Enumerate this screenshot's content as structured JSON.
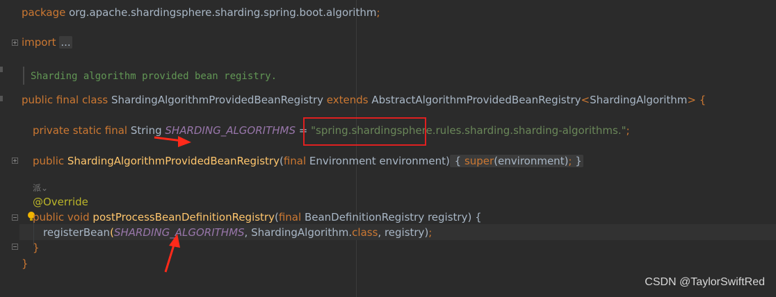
{
  "code": {
    "package_kw": "package",
    "package_name": " org.apache.shardingsphere.sharding.spring.boot.algorithm",
    "package_semi": ";",
    "import_kw": "import",
    "import_folded": "...",
    "javadoc": "Sharding algorithm provided bean registry.",
    "class_kw": "public final class",
    "class_name": " ShardingAlgorithmProvidedBeanRegistry ",
    "extends_kw": "extends",
    "super_type": " AbstractAlgorithmProvidedBeanRegistry",
    "generic_open": "<",
    "generic_type": "ShardingAlgorithm",
    "generic_close": "> {",
    "field_kw": "private static final",
    "field_type": " String ",
    "field_name": "SHARDING_ALGORITHMS",
    "field_eq": " = ",
    "field_value": "\"spring.shardingsphere.rules.sharding.sharding-algorithms.\"",
    "field_semi": ";",
    "ctor_kw": "public",
    "ctor_name": " ShardingAlgorithmProvidedBeanRegistry",
    "ctor_paren_open": "(",
    "ctor_final": "final",
    "ctor_param": " Environment environment)",
    "ctor_body_open": " { ",
    "ctor_super": "super",
    "ctor_super_args": "(environment)",
    "ctor_semi": ";",
    "ctor_body_close": " }",
    "author_hint": "派⌄",
    "annotation": "@Override",
    "method_kw": "public void",
    "method_name": " postProcessBeanDefinitionRegistry",
    "method_paren_open": "(",
    "method_final": "final",
    "method_params": " BeanDefinitionRegistry registry) {",
    "call_name": "registerBean",
    "call_open": "(",
    "call_const": "SHARDING_ALGORITHMS",
    "call_mid": ", ShardingAlgorithm.",
    "call_class_kw": "class",
    "call_end": ", registry)",
    "call_semi": ";",
    "method_close": "}",
    "class_close": "}"
  },
  "watermark": "CSDN @TaylorSwiftRed",
  "colors": {
    "background": "#2b2b2b",
    "keyword": "#cc7832",
    "function": "#ffc66d",
    "constant": "#9876aa",
    "string": "#6a8759",
    "annotation": "#bbb529",
    "highlight_box": "#e02020"
  }
}
